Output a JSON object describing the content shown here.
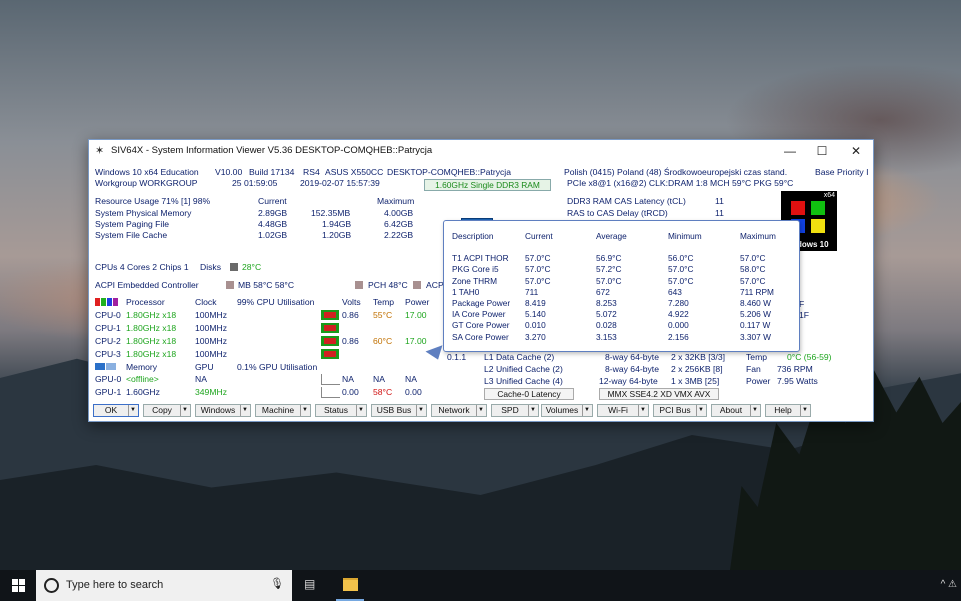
{
  "window": {
    "title": "SIV64X - System Information Viewer V5.36 DESKTOP-COMQHEB::Patrycja",
    "controls": {
      "minimize": "—",
      "maximize": "☐",
      "close": "✕"
    }
  },
  "header": {
    "row1": [
      "Windows 10 x64 Education",
      "V10.00",
      "Build 17134",
      "RS4",
      "ASUS X550CC",
      "DESKTOP-COMQHEB::Patrycja"
    ],
    "row2": [
      "Workgroup WORKGROUP",
      "25 01:59:05",
      "2019-02-07 15:57:39"
    ],
    "ram_badge": "1.60GHz Single DDR3 RAM",
    "locale": "Polish (0415)  Poland (48)  Środkowoeuropejski czas stand.",
    "base_priority": "Base Priority I",
    "pcie": "PCIe x8@1 (x16@2) CLK:DRAM 1:8  MCH 59°C  PKG 59°C"
  },
  "memory": {
    "usage_label": "Resource Usage 71% [1] 98%",
    "current": "Current",
    "maximum": "Maximum",
    "rows": [
      {
        "label": "System Physical Memory",
        "cur": "2.89GB",
        "mid": "152.35MB",
        "max": "4.00GB"
      },
      {
        "label": "System Paging File",
        "cur": "4.48GB",
        "mid": "1.94GB",
        "max": "6.42GB"
      },
      {
        "label": "System File Cache",
        "cur": "1.02GB",
        "mid": "1.20GB",
        "max": "2.22GB"
      }
    ]
  },
  "dram": [
    {
      "label": "DDR3 RAM CAS Latency (tCL)",
      "value": "11"
    },
    {
      "label": "RAS to CAS Delay (tRCD)",
      "value": "11"
    }
  ],
  "cpus_line": "CPUs 4 Cores 2 Chips 1",
  "disks_label": "Disks",
  "disks_temp": "28°C",
  "acpi": {
    "label": "ACPI Embedded Controller",
    "mb": "MB 58°C 58°C",
    "pch": "PCH 48°C",
    "acp": "ACP"
  },
  "cpu_table": {
    "headers": [
      "Processor",
      "Clock",
      "99% CPU Utilisation",
      "Volts",
      "Temp",
      "Power"
    ],
    "rows": [
      {
        "name": "CPU-0",
        "freq": "1.80GHz x18",
        "clock": "100MHz",
        "volts": "0.86",
        "temp": "55°C",
        "power": "17.00"
      },
      {
        "name": "CPU-1",
        "freq": "1.80GHz x18",
        "clock": "100MHz",
        "volts": "",
        "temp": "",
        "power": ""
      },
      {
        "name": "CPU-2",
        "freq": "1.80GHz x18",
        "clock": "100MHz",
        "volts": "0.86",
        "temp": "60°C",
        "power": "17.00"
      },
      {
        "name": "CPU-3",
        "freq": "1.80GHz x18",
        "clock": "100MHz",
        "volts": "",
        "temp": "",
        "power": ""
      }
    ]
  },
  "gpu_table": {
    "memory_label": "Memory",
    "gpu_label": "GPU",
    "util": "0.1% GPU Utilisation",
    "rows": [
      {
        "name": "GPU-0",
        "a": "<offline>",
        "b": "NA",
        "volts": "NA",
        "temp": "NA",
        "power": "NA"
      },
      {
        "name": "GPU-1",
        "a": "1.60GHz",
        "b": "349MHz",
        "volts": "0.00",
        "temp": "58°C",
        "power": "0.00"
      }
    ]
  },
  "cache": {
    "prefix": "0.1.1",
    "rows": [
      {
        "label": "L1 Data Cache (2)",
        "way": "8-way 64-byte",
        "size": "2 x 32KB [3/3]"
      },
      {
        "label": "L2 Unified Cache (2)",
        "way": "8-way 64-byte",
        "size": "2 x 256KB [8]"
      },
      {
        "label": "L3 Unified Cache (4)",
        "way": "12-way 64-byte",
        "size": "1 x 3MB  [25]"
      }
    ],
    "latency_button": "Cache-0 Latency",
    "isa": "MMX SSE4.2 XD VMX AVX"
  },
  "sensor_side": {
    "temp_label": "Temp",
    "temp_value": "0°C (56-59)",
    "fan_label": "Fan",
    "fan_value": "736 RPM",
    "power_label": "Power",
    "power_value": "7.95 Watts",
    "frag1": "F",
    "frag2": "1F"
  },
  "tooltip": {
    "headers": [
      "Description",
      "Current",
      "Average",
      "Minimum",
      "Maximum"
    ],
    "rows": [
      [
        "T1 ACPI THOR",
        "57.0°C",
        "56.9°C",
        "56.0°C",
        "57.0°C"
      ],
      [
        "PKG Core i5",
        "57.0°C",
        "57.2°C",
        "57.0°C",
        "58.0°C"
      ],
      [
        "Zone THRM",
        "57.0°C",
        "57.0°C",
        "57.0°C",
        "57.0°C"
      ],
      [
        "1 TAH0",
        "711",
        "672",
        "643",
        "711 RPM"
      ],
      [
        "Package Power",
        "8.419",
        "8.253",
        "7.280",
        "8.460 W"
      ],
      [
        "IA Core Power",
        "5.140",
        "5.072",
        "4.922",
        "5.206 W"
      ],
      [
        "GT Core Power",
        "0.010",
        "0.028",
        "0.000",
        "0.117 W"
      ],
      [
        "SA Core Power",
        "3.270",
        "3.153",
        "2.156",
        "3.307 W"
      ]
    ]
  },
  "logo": {
    "intel": "intel",
    "win_label": "dows 10",
    "x64": "x64"
  },
  "toolbar": [
    "OK",
    "Copy",
    "Windows",
    "Machine",
    "Status",
    "USB Bus",
    "Network",
    "SPD",
    "Volumes",
    "Wi-Fi",
    "PCI Bus",
    "About",
    "Help"
  ],
  "taskbar": {
    "search_placeholder": "Type here to search"
  }
}
